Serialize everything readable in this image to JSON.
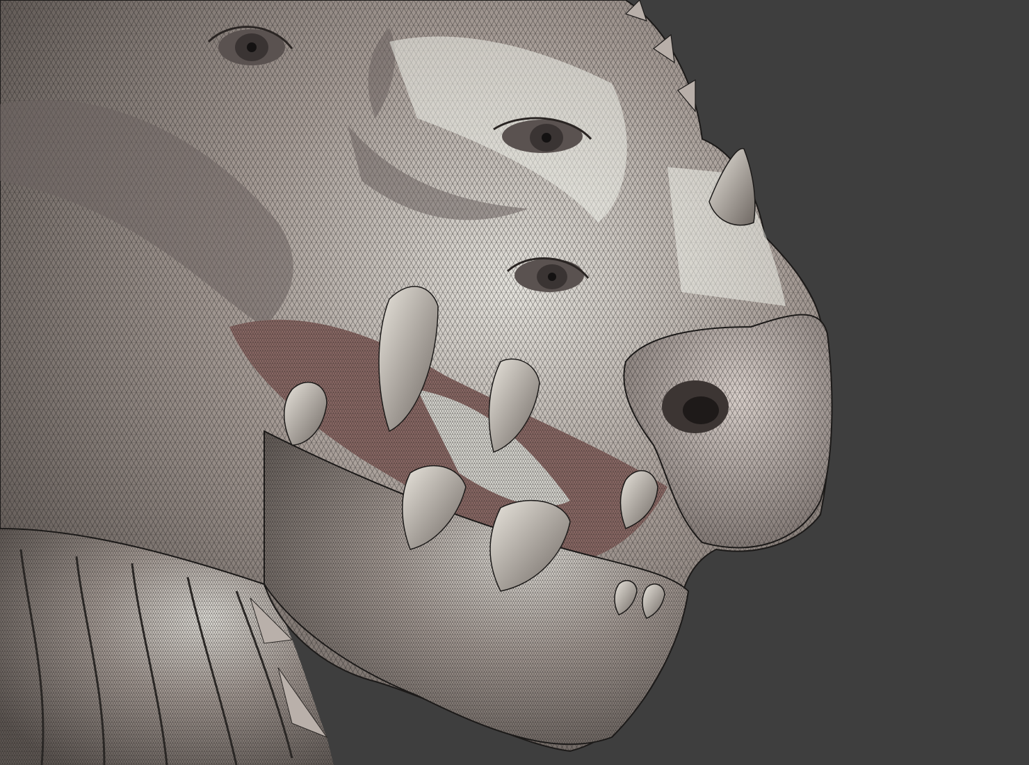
{
  "viewport": {
    "background_color": "#3e3e3e",
    "mesh_color": "#1c1a19",
    "surface_light": "#e4e2dc",
    "surface_mid": "#a49a94",
    "surface_dark": "#5e5753",
    "mouth_interior": "#8c6a66",
    "tooth_color": "#d8d4cc"
  },
  "subject": {
    "kind": "wireframe-sculpt-dragon-head",
    "shading": "shaded-with-wireframe-overlay",
    "features": [
      "eye-upper",
      "eye-middle",
      "eye-lower",
      "nostril",
      "horn",
      "teeth",
      "neck-spines"
    ]
  }
}
